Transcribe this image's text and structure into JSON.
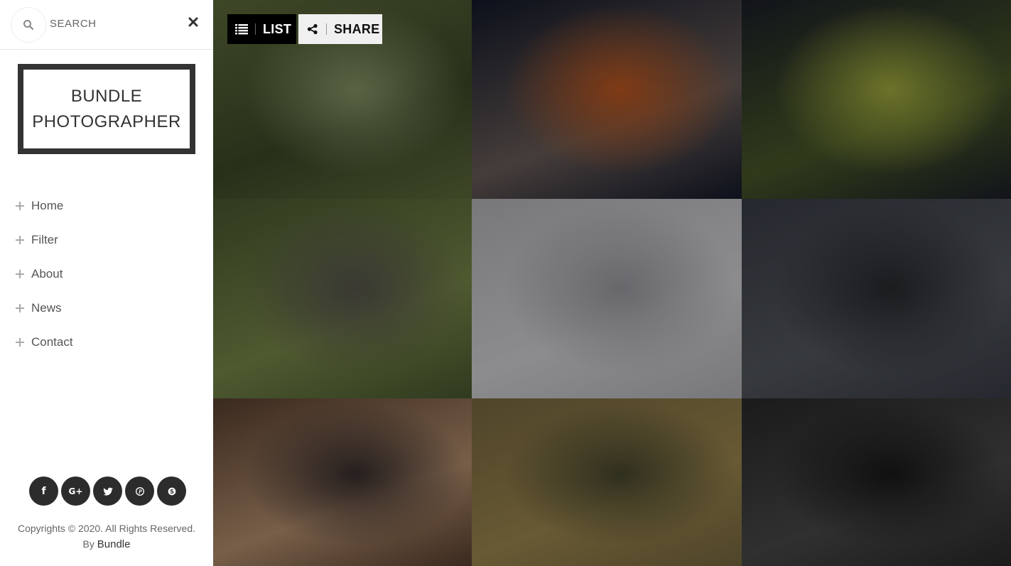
{
  "search": {
    "placeholder": "SEARCH"
  },
  "logo": {
    "line1": "BUNDLE",
    "line2": "PHOTOGRAPHER"
  },
  "nav": {
    "items": [
      {
        "label": "Home"
      },
      {
        "label": "Filter"
      },
      {
        "label": "About"
      },
      {
        "label": "News"
      },
      {
        "label": "Contact"
      }
    ]
  },
  "socials": [
    {
      "icon": "facebook-icon",
      "glyph": "f"
    },
    {
      "icon": "google-plus-icon",
      "glyph": "G+"
    },
    {
      "icon": "twitter-icon"
    },
    {
      "icon": "pinterest-icon"
    },
    {
      "icon": "skype-icon"
    }
  ],
  "footer": {
    "copyright": "Copyrights © 2020. All Rights Reserved.",
    "by": "By",
    "brand": "Bundle"
  },
  "toolbar": {
    "list_label": "LIST",
    "share_label": "SHARE"
  },
  "gallery": {
    "tiles": [
      {
        "name": "orangutan-in-rain-photo",
        "colors": [
          "#5f6e3c",
          "#3e4a28",
          "#8a9a6a"
        ]
      },
      {
        "name": "mountain-night-sunset-photo",
        "colors": [
          "#141a2a",
          "#6a5e5a",
          "#c35a20"
        ]
      },
      {
        "name": "spider-web-photo",
        "colors": [
          "#1c2028",
          "#4a5a2a",
          "#a7b040"
        ]
      },
      {
        "name": "lego-stormtrooper-bike-photo",
        "colors": [
          "#4a5a30",
          "#7a8a4a",
          "#5a5850"
        ]
      },
      {
        "name": "gannets-with-plant-photo",
        "colors": [
          "#b9b9be",
          "#d8d8dc",
          "#a0a0a6"
        ]
      },
      {
        "name": "pier-with-umbrella-photo",
        "colors": [
          "#3a3e48",
          "#55595f",
          "#2a2c30"
        ]
      },
      {
        "name": "boy-with-dog-sunset-photo",
        "colors": [
          "#5a4030",
          "#b89270",
          "#3a3030"
        ]
      },
      {
        "name": "lioness-zebra-photo",
        "colors": [
          "#7a6a40",
          "#a08a50",
          "#4a4a30"
        ]
      },
      {
        "name": "man-bowing-to-horse-photo",
        "colors": [
          "#2a2a2a",
          "#4a4a4a",
          "#1a1a1a"
        ]
      }
    ]
  }
}
